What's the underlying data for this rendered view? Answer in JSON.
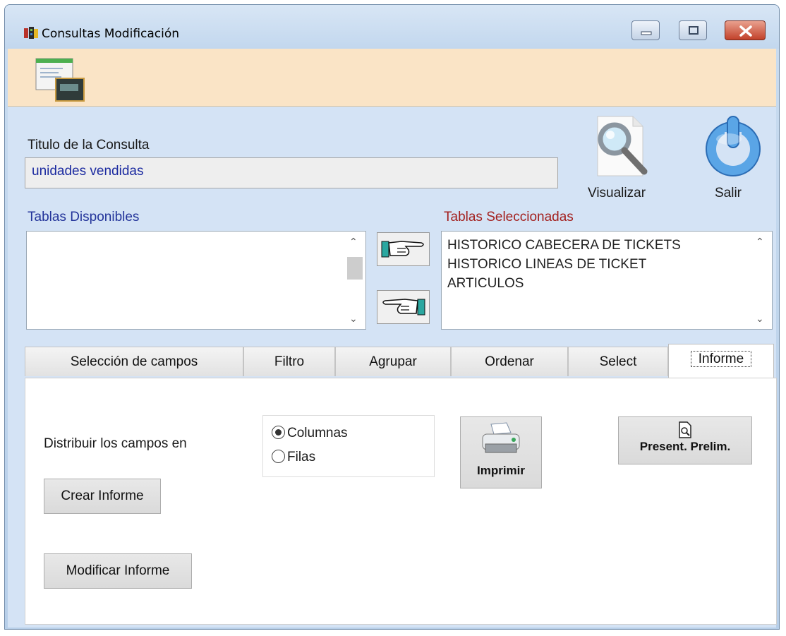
{
  "window": {
    "title": "Consultas Modificación"
  },
  "form": {
    "titulo_label": "Titulo de la Consulta",
    "titulo_value": "unidades vendidas",
    "visualizar_label": "Visualizar",
    "salir_label": "Salir",
    "tablas_disponibles_label": "Tablas Disponibles",
    "tablas_seleccionadas_label": "Tablas Seleccionadas",
    "tablas_disponibles": [],
    "tablas_seleccionadas": [
      "HISTORICO CABECERA DE TICKETS",
      "HISTORICO LINEAS DE TICKET",
      "ARTICULOS"
    ]
  },
  "tabs": [
    {
      "label": "Selección de campos",
      "active": false
    },
    {
      "label": "Filtro",
      "active": false
    },
    {
      "label": "Agrupar",
      "active": false
    },
    {
      "label": "Ordenar",
      "active": false
    },
    {
      "label": "Select",
      "active": false
    },
    {
      "label": "Informe",
      "active": true
    }
  ],
  "informe": {
    "distribuir_label": "Distribuir los campos en",
    "radio_columnas": "Columnas",
    "radio_filas": "Filas",
    "selected": "Columnas",
    "imprimir_label": "Imprimir",
    "presentacion_label": "Present. Prelim.",
    "crear_label": "Crear Informe",
    "modificar_label": "Modificar Informe"
  },
  "colors": {
    "title_value": "#1b2aa0",
    "label_blue": "#23349a",
    "label_red": "#a3201e",
    "toolbar": "#fae4c6",
    "client": "#d4e3f5"
  },
  "icons": {
    "app": "film-strip-icon",
    "toolbar": "query-window-icon",
    "visualizar": "magnifier-document-icon",
    "salir": "power-icon",
    "add": "hand-pointing-right-icon",
    "remove": "hand-pointing-left-icon",
    "imprimir": "printer-icon",
    "preview": "page-magnifier-icon"
  }
}
